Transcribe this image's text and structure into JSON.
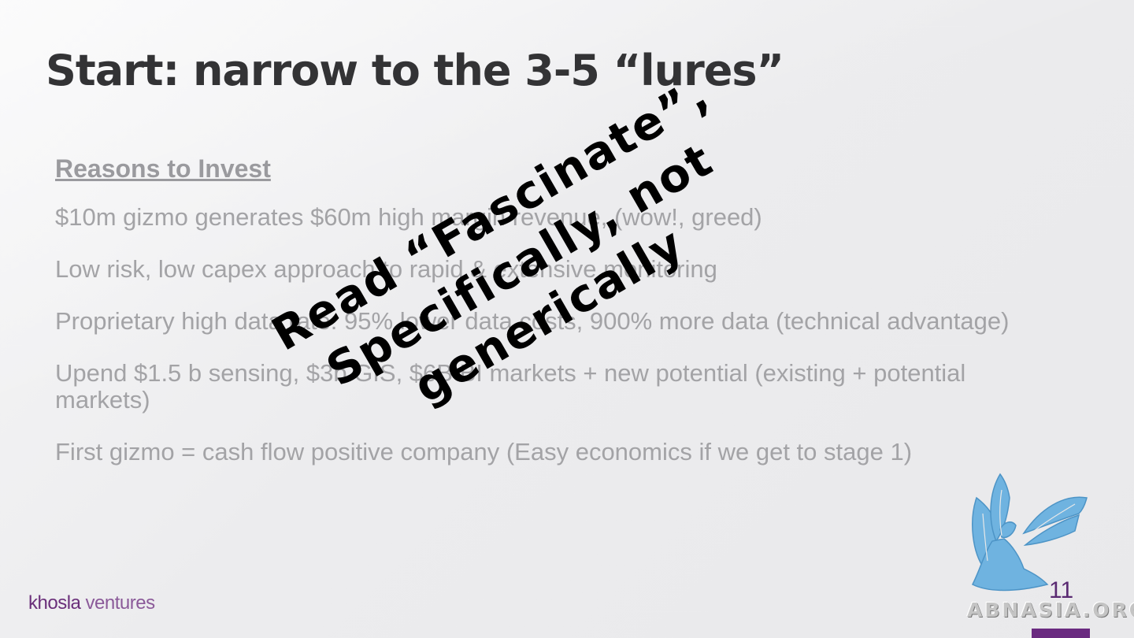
{
  "slide": {
    "title": "Start: narrow to the 3-5 “lures”",
    "number": "11"
  },
  "reasons": {
    "heading": "Reasons to Invest",
    "items": [
      "$10m gizmo generates $60m high margin revenue, (wow!, greed)",
      "Low risk, low capex approach to rapid & extensive monitoring",
      "Proprietary high data rate: 95% lower data costs, 900% more data (technical advantage)",
      "Upend $1.5 b sensing, $3b GIS, $6B BI markets + new potential (existing + potential markets)",
      "First gizmo = cash flow positive company (Easy economics if we get to stage 1)"
    ]
  },
  "overlay": {
    "lines": [
      "Read “Fascinate”,",
      "Specifically, not",
      "generically"
    ]
  },
  "footer": {
    "logo_part1": "khosla",
    "logo_part2": "ventures"
  },
  "watermark": {
    "text": "ABNASIA.ORG",
    "icon": "griffin-icon"
  },
  "colors": {
    "title": "#333335",
    "body_text": "#a3a3a6",
    "overlay_text": "#000000",
    "brand_purple": "#6a2a80",
    "watermark_blue": "#6fb3e0"
  }
}
